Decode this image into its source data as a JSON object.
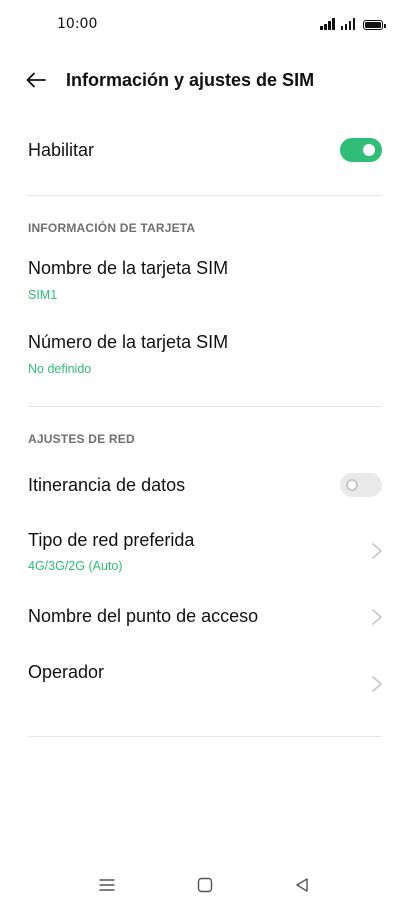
{
  "status_bar": {
    "time": "10:00",
    "battery_level": 1.0
  },
  "app_bar": {
    "title": "Información y ajustes de SIM"
  },
  "enable": {
    "label": "Habilitar",
    "on": true
  },
  "card_info": {
    "header": "INFORMACIÓN DE TARJETA",
    "items": [
      {
        "title": "Nombre de la tarjeta SIM",
        "value": "SIM1"
      },
      {
        "title": "Número de la tarjeta SIM",
        "value": "No definido"
      }
    ]
  },
  "network": {
    "header": "AJUSTES DE RED",
    "roaming": {
      "label": "Itinerancia de datos",
      "on": false
    },
    "preferred_network": {
      "title": "Tipo de red preferida",
      "value": "4G/3G/2G (Auto)"
    },
    "apn": {
      "title": "Nombre del punto de acceso"
    },
    "operator": {
      "title": "Operador"
    }
  },
  "colors": {
    "accent": "#2fbd77",
    "text": "#111111",
    "section": "#6f6f6f"
  },
  "nav_bar": {
    "icons": [
      "menu-icon",
      "home-icon",
      "back-triangle-icon"
    ]
  }
}
